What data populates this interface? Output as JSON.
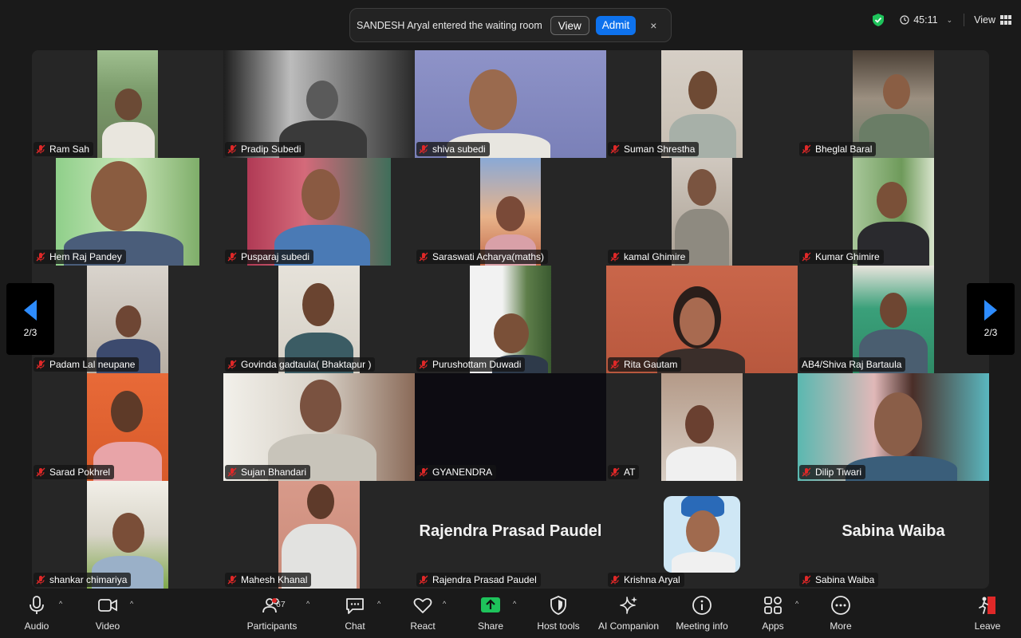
{
  "notification": {
    "message": "SANDESH Aryal entered the waiting room",
    "view_label": "View",
    "admit_label": "Admit",
    "close_glyph": "×"
  },
  "header": {
    "timer": "45:11",
    "view_label": "View",
    "security_color": "#1ec35b"
  },
  "pager": {
    "label": "2/3",
    "arrow_color": "#2d8cff"
  },
  "participants": [
    {
      "name": "Ram Sah",
      "muted": true
    },
    {
      "name": "Pradip Subedi",
      "muted": true
    },
    {
      "name": "shiva subedi",
      "muted": true
    },
    {
      "name": "Suman Shrestha",
      "muted": true
    },
    {
      "name": "Bheglal Baral",
      "muted": true
    },
    {
      "name": "Hem Raj Pandey",
      "muted": true
    },
    {
      "name": "Pusparaj subedi",
      "muted": true
    },
    {
      "name": "Saraswati Acharya(maths)",
      "muted": true
    },
    {
      "name": "kamal Ghimire",
      "muted": true
    },
    {
      "name": "Kumar Ghimire",
      "muted": true
    },
    {
      "name": "Padam Lal neupane",
      "muted": true
    },
    {
      "name": "Govinda gadtaula( Bhaktapur )",
      "muted": true
    },
    {
      "name": "Purushottam Duwadi",
      "muted": true
    },
    {
      "name": "Rita Gautam",
      "muted": true
    },
    {
      "name": "AB4/Shiva Raj Bartaula",
      "muted": false
    },
    {
      "name": "Sarad Pokhrel",
      "muted": true
    },
    {
      "name": "Sujan Bhandari",
      "muted": true
    },
    {
      "name": "GYANENDRA",
      "muted": true
    },
    {
      "name": "AT",
      "muted": true
    },
    {
      "name": "Dilip Tiwari",
      "muted": true
    },
    {
      "name": "shankar chimariya",
      "muted": true
    },
    {
      "name": "Mahesh Khanal",
      "muted": true
    },
    {
      "name": "Rajendra Prasad Paudel",
      "muted": true
    },
    {
      "name": "Krishna Aryal",
      "muted": true
    },
    {
      "name": "Sabina Waiba",
      "muted": true
    }
  ],
  "toolbar": {
    "audio": "Audio",
    "video": "Video",
    "participants": "Participants",
    "participants_count": "67",
    "chat": "Chat",
    "react": "React",
    "share": "Share",
    "host_tools": "Host tools",
    "ai_companion": "AI Companion",
    "meeting_info": "Meeting info",
    "apps": "Apps",
    "more": "More",
    "leave": "Leave",
    "share_color": "#1ec35b",
    "leave_color": "#e02828"
  }
}
